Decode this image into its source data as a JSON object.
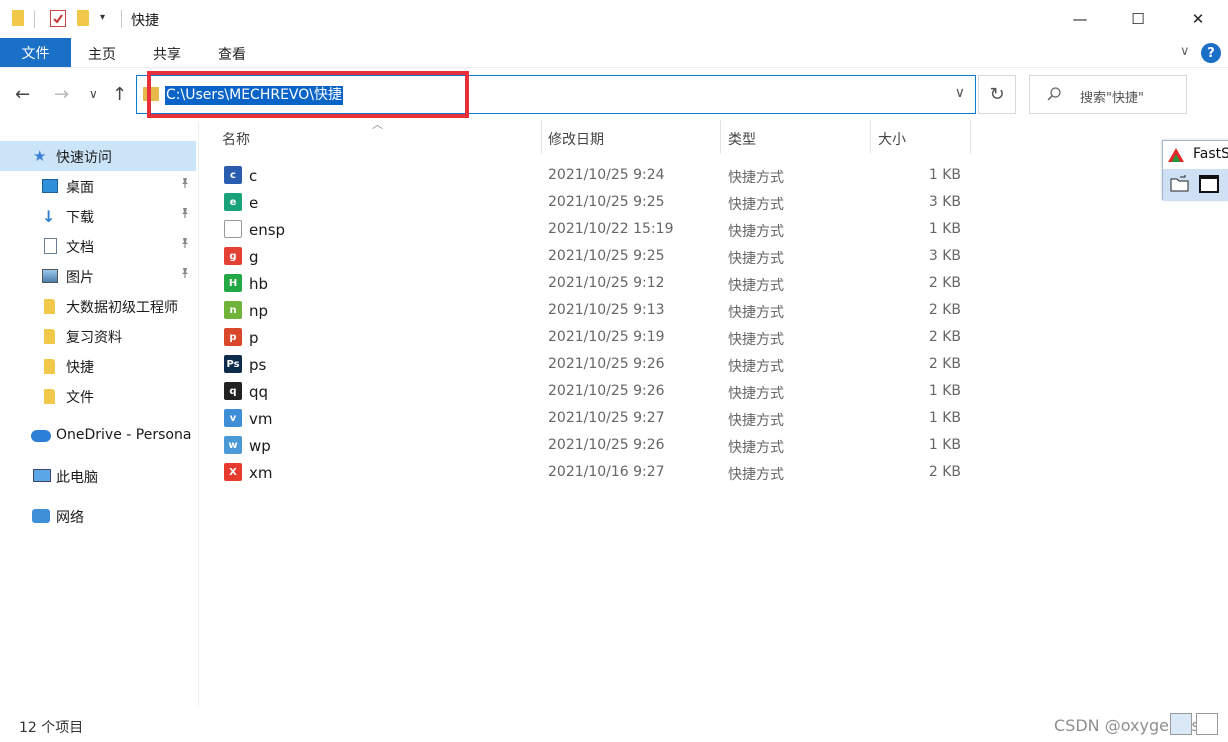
{
  "window": {
    "title": "快捷",
    "minimize_glyph": "—",
    "maximize_glyph": "☐",
    "close_glyph": "✕"
  },
  "ribbon": {
    "tabs": [
      "文件",
      "主页",
      "共享",
      "查看"
    ],
    "expand_glyph": "∨",
    "help_glyph": "?"
  },
  "nav": {
    "back_glyph": "←",
    "forward_glyph": "→",
    "recent_glyph": "∨",
    "up_glyph": "↑",
    "address": "C:\\Users\\MECHREVO\\快捷",
    "address_dropdown_glyph": "∨",
    "refresh_glyph": "↻",
    "search_placeholder": "搜索\"快捷\""
  },
  "sidebar": {
    "items": [
      {
        "label": "快速访问",
        "icon": "star-icon",
        "pinned": false
      },
      {
        "label": "桌面",
        "icon": "desktop-icon",
        "pinned": true
      },
      {
        "label": "下载",
        "icon": "download-icon",
        "pinned": true
      },
      {
        "label": "文档",
        "icon": "document-icon",
        "pinned": true
      },
      {
        "label": "图片",
        "icon": "picture-icon",
        "pinned": true
      },
      {
        "label": "大数据初级工程师",
        "icon": "folder-icon",
        "pinned": false
      },
      {
        "label": "复习资料",
        "icon": "folder-icon",
        "pinned": false
      },
      {
        "label": "快捷",
        "icon": "folder-icon",
        "pinned": false
      },
      {
        "label": "文件",
        "icon": "folder-icon",
        "pinned": false
      },
      {
        "label": "OneDrive - Persona",
        "icon": "cloud-icon",
        "pinned": false
      },
      {
        "label": "此电脑",
        "icon": "computer-icon",
        "pinned": false
      },
      {
        "label": "网络",
        "icon": "network-icon",
        "pinned": false
      }
    ],
    "pin_glyph": "📌"
  },
  "columns": [
    "名称",
    "修改日期",
    "类型",
    "大小"
  ],
  "files": [
    {
      "name": "c",
      "date": "2021/10/25 9:24",
      "type": "快捷方式",
      "size": "1 KB",
      "icon_color": "#2a5db0",
      "icon_glyph": "c"
    },
    {
      "name": "e",
      "date": "2021/10/25 9:25",
      "type": "快捷方式",
      "size": "3 KB",
      "icon_color": "#1aa37a",
      "icon_glyph": "e"
    },
    {
      "name": "ensp",
      "date": "2021/10/22 15:19",
      "type": "快捷方式",
      "size": "1 KB",
      "icon_color": "#e8e8e8",
      "icon_glyph": ""
    },
    {
      "name": "g",
      "date": "2021/10/25 9:25",
      "type": "快捷方式",
      "size": "3 KB",
      "icon_color": "#e44134",
      "icon_glyph": "g"
    },
    {
      "name": "hb",
      "date": "2021/10/25 9:12",
      "type": "快捷方式",
      "size": "2 KB",
      "icon_color": "#22a845",
      "icon_glyph": "H"
    },
    {
      "name": "np",
      "date": "2021/10/25 9:13",
      "type": "快捷方式",
      "size": "2 KB",
      "icon_color": "#6fb33b",
      "icon_glyph": "n"
    },
    {
      "name": "p",
      "date": "2021/10/25 9:19",
      "type": "快捷方式",
      "size": "2 KB",
      "icon_color": "#d9482b",
      "icon_glyph": "p"
    },
    {
      "name": "ps",
      "date": "2021/10/25 9:26",
      "type": "快捷方式",
      "size": "2 KB",
      "icon_color": "#0d2b4a",
      "icon_glyph": "Ps"
    },
    {
      "name": "qq",
      "date": "2021/10/25 9:26",
      "type": "快捷方式",
      "size": "1 KB",
      "icon_color": "#222222",
      "icon_glyph": "q"
    },
    {
      "name": "vm",
      "date": "2021/10/25 9:27",
      "type": "快捷方式",
      "size": "1 KB",
      "icon_color": "#3d8ed6",
      "icon_glyph": "v"
    },
    {
      "name": "wp",
      "date": "2021/10/25 9:26",
      "type": "快捷方式",
      "size": "1 KB",
      "icon_color": "#4a9ad8",
      "icon_glyph": "w"
    },
    {
      "name": "xm",
      "date": "2021/10/16 9:27",
      "type": "快捷方式",
      "size": "2 KB",
      "icon_color": "#e63b2e",
      "icon_glyph": "X"
    }
  ],
  "floating_window": {
    "title": "FastS"
  },
  "status": {
    "item_count": "12 个项目",
    "watermark": "CSDN @oxygen_ls"
  },
  "colors": {
    "accent": "#1a6fc6",
    "selection": "#cce4f7",
    "highlight_box": "#e8303a"
  }
}
